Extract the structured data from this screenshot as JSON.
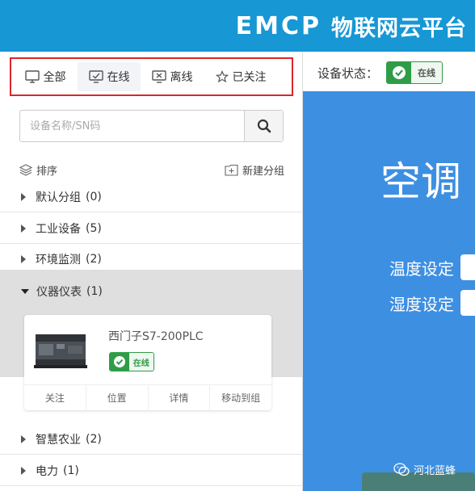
{
  "header": {
    "logo": "EMCP",
    "title": "物联网云平台",
    "bg_color": "#1797d4"
  },
  "tabs": [
    {
      "label": "全部",
      "icon": "monitor-icon"
    },
    {
      "label": "在线",
      "icon": "monitor-check-icon",
      "active": true
    },
    {
      "label": "离线",
      "icon": "monitor-x-icon"
    },
    {
      "label": "已关注",
      "icon": "star-icon"
    }
  ],
  "search": {
    "placeholder": "设备名称/SN码"
  },
  "sort_label": "排序",
  "new_group_label": "新建分组",
  "groups": [
    {
      "name": "默认分组",
      "count": "(0)"
    },
    {
      "name": "工业设备",
      "count": "(5)"
    },
    {
      "name": "环境监测",
      "count": "(2)"
    },
    {
      "name": "仪器仪表",
      "count": "(1)",
      "expanded": true
    },
    {
      "name": "智慧农业",
      "count": "(2)"
    },
    {
      "name": "电力",
      "count": "(1)"
    }
  ],
  "device": {
    "name": "西门子S7-200PLC",
    "status": "在线",
    "actions": [
      "关注",
      "位置",
      "详情",
      "移动到组"
    ]
  },
  "detail": {
    "status_label": "设备状态：",
    "status": "在线",
    "panel_title": "空调",
    "settings": [
      "温度设定",
      "湿度设定"
    ],
    "panel_color": "#3d8fe2"
  },
  "watermark": "河北蓝蜂",
  "colors": {
    "accent": "#1797d4",
    "online_green": "#2f9d47",
    "highlight_border": "#d9262c"
  }
}
